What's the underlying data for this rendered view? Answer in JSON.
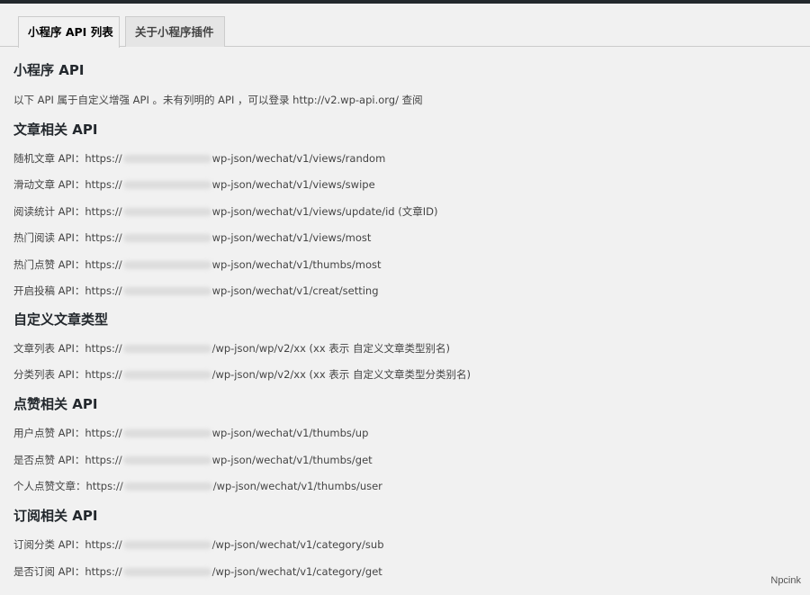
{
  "tabs": [
    {
      "label": "小程序 API 列表",
      "active": true
    },
    {
      "label": "关于小程序插件",
      "active": false
    }
  ],
  "intro": {
    "title": "小程序 API",
    "text": "以下 API 属于自定义增强 API 。未有列明的 API ，可以登录 http://v2.wp-api.org/ 查阅"
  },
  "sections": [
    {
      "title": "文章相关 API",
      "items": [
        {
          "label": "随机文章 API：https://",
          "path": "wp-json/wechat/v1/views/random"
        },
        {
          "label": "滑动文章 API：https://",
          "path": "wp-json/wechat/v1/views/swipe"
        },
        {
          "label": "阅读统计 API：https://",
          "path": "wp-json/wechat/v1/views/update/id (文章ID)"
        },
        {
          "label": "热门阅读 API：https://",
          "path": "wp-json/wechat/v1/views/most"
        },
        {
          "label": "热门点赞 API：https://",
          "path": "wp-json/wechat/v1/thumbs/most"
        },
        {
          "label": "开启投稿 API：https://",
          "path": "wp-json/wechat/v1/creat/setting"
        }
      ]
    },
    {
      "title": "自定义文章类型",
      "items": [
        {
          "label": "文章列表 API：https://",
          "path": "/wp-json/wp/v2/xx (xx 表示 自定义文章类型别名)"
        },
        {
          "label": "分类列表 API：https://",
          "path": "/wp-json/wp/v2/xx (xx 表示 自定义文章类型分类别名)"
        }
      ]
    },
    {
      "title": "点赞相关 API",
      "items": [
        {
          "label": "用户点赞 API：https://",
          "path": "wp-json/wechat/v1/thumbs/up"
        },
        {
          "label": "是否点赞 API：https://",
          "path": "wp-json/wechat/v1/thumbs/get"
        },
        {
          "label": "个人点赞文章：https://",
          "path": "/wp-json/wechat/v1/thumbs/user"
        }
      ]
    },
    {
      "title": "订阅相关 API",
      "items": [
        {
          "label": "订阅分类 API：https://",
          "path": "/wp-json/wechat/v1/category/sub"
        },
        {
          "label": "是否订阅 API：https://",
          "path": "/wp-json/wechat/v1/category/get"
        }
      ]
    }
  ],
  "watermark": "Npcink"
}
